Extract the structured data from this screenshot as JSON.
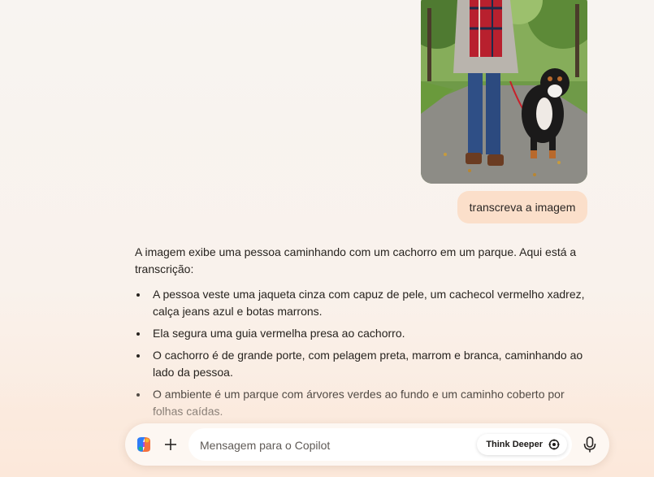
{
  "message": {
    "user_text": "transcreva a imagem"
  },
  "response": {
    "intro": "A imagem exibe uma pessoa caminhando com um cachorro em um parque. Aqui está a transcrição:",
    "bullets": [
      "A pessoa veste uma jaqueta cinza com capuz de pele, um cachecol vermelho xadrez, calça jeans azul e botas marrons.",
      "Ela segura uma guia vermelha presa ao cachorro.",
      "O cachorro é de grande porte, com pelagem preta, marrom e branca, caminhando ao lado da pessoa.",
      "O ambiente é um parque com árvores verdes ao fundo e um caminho coberto por folhas caídas."
    ]
  },
  "composer": {
    "placeholder": "Mensagem para o Copilot",
    "think_deeper_label": "Think Deeper"
  },
  "icons": {
    "logo": "copilot-logo-icon",
    "add": "plus-icon",
    "think": "think-deeper-icon",
    "mic": "microphone-icon"
  },
  "colors": {
    "user_bubble": "#fbdfca",
    "background": "#f8f4f1"
  }
}
